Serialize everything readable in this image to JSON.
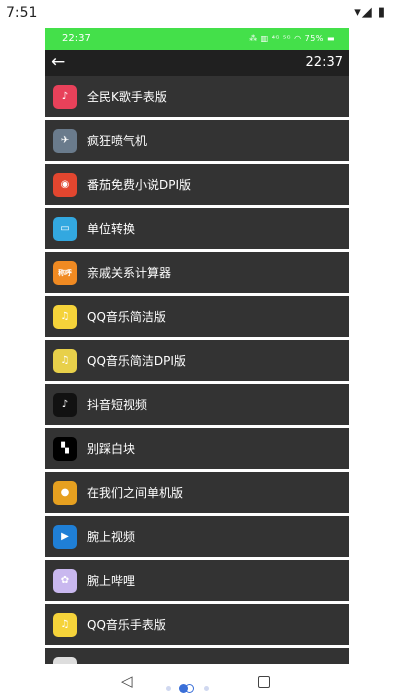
{
  "system": {
    "time": "7:51",
    "icons": "▾◢ ▮"
  },
  "watch": {
    "status_time": "22:37",
    "status_icons": "⁂ ▥ ⁴ᴳ ⁵ᴳ ◠ 75% ▬",
    "bar_time": "22:37",
    "back_icon": "←",
    "bar_color": "#44e04a"
  },
  "apps": [
    {
      "label": "全民K歌手表版",
      "icon": "♪",
      "color": "#e8415a",
      "icon_name": "karaoke-icon"
    },
    {
      "label": "疯狂喷气机",
      "icon": "✈",
      "color": "#6a7b8c",
      "icon_name": "jetpack-icon"
    },
    {
      "label": "番茄免费小说DPI版",
      "icon": "◉",
      "color": "#e2462f",
      "icon_name": "tomato-novel-icon"
    },
    {
      "label": "单位转换",
      "icon": "▭",
      "color": "#33a8e0",
      "icon_name": "unit-convert-icon"
    },
    {
      "label": "亲戚关系计算器",
      "icon": "称呼",
      "color": "#f08a22",
      "icon_name": "relative-calculator-icon",
      "tiny": true
    },
    {
      "label": "QQ音乐简洁版",
      "icon": "♫",
      "color": "#f5d33a",
      "icon_name": "qq-music-icon"
    },
    {
      "label": "QQ音乐简洁DPI版",
      "icon": "♫",
      "color": "#e8d04a",
      "icon_name": "qq-music-dpi-icon"
    },
    {
      "label": "抖音短视频",
      "icon": "♪",
      "color": "#111111",
      "icon_name": "douyin-icon"
    },
    {
      "label": "别踩白块",
      "icon": "▚",
      "color": "#000000",
      "icon_name": "piano-tiles-icon"
    },
    {
      "label": "在我们之间单机版",
      "icon": "●",
      "color": "#e6a020",
      "icon_name": "among-us-icon"
    },
    {
      "label": "腕上视频",
      "icon": "▶",
      "color": "#1f7fd6",
      "icon_name": "wrist-video-icon"
    },
    {
      "label": "腕上哔哩",
      "icon": "✿",
      "color": "#c9b8ef",
      "icon_name": "wrist-bilibili-icon"
    },
    {
      "label": "QQ音乐手表版",
      "icon": "♫",
      "color": "#f5d33a",
      "icon_name": "qq-music-watch-icon"
    },
    {
      "label": "",
      "icon": "",
      "color": "#dddddd",
      "icon_name": "partial-icon"
    }
  ],
  "nav": {
    "back_icon": "◁",
    "recents_icon": "square"
  }
}
